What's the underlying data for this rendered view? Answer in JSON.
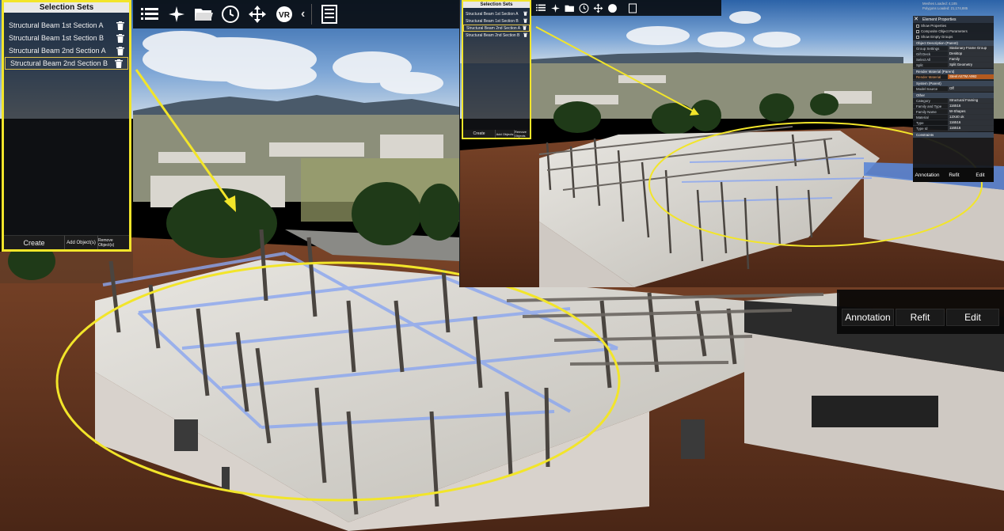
{
  "main_panel": {
    "title": "Selection Sets",
    "items": [
      {
        "label": "Structural Beam 1st Section A"
      },
      {
        "label": "Structural Beam 1st Section B"
      },
      {
        "label": "Structural Beam 2nd Section A"
      },
      {
        "label": "Structural Beam 2nd Section B"
      }
    ],
    "create_label": "Create",
    "add_label": "Add Object(s)",
    "remove_label": "Remove Object(s)"
  },
  "main_actions": {
    "annotation_label": "Annotation",
    "refit_label": "Refit",
    "edit_label": "Edit"
  },
  "inset": {
    "panel_title": "Selection Sets",
    "items": [
      {
        "label": "Structural Beam 1st Section A"
      },
      {
        "label": "Structural Beam 1st Section B"
      },
      {
        "label": "Structural Beam 2nd Section A"
      },
      {
        "label": "Structural Beam 2nd Section B"
      }
    ],
    "create_label": "Create",
    "add_label": "Add Objects",
    "remove_label": "Remove Objects",
    "stats": {
      "meshes": "Meshes Loaded: 4,185",
      "polygons": "Polygons Loaded: 21,174,885"
    },
    "properties": {
      "title": "Element Properties",
      "checks": [
        "Show Properties",
        "Composite Object Parameters",
        "Show Empty Groups"
      ],
      "sections": [
        {
          "name": "Object Description (Parent)",
          "rows": [
            {
              "k": "Group Settings",
              "v": "Stationary Frame Group"
            },
            {
              "k": "Gift Deck",
              "v": "Desktop"
            },
            {
              "k": "Select All",
              "v": "Family"
            },
            {
              "k": "Split",
              "v": "Split Geometry"
            }
          ]
        },
        {
          "name": "Render Material (Parent)",
          "rows": [
            {
              "k": "Render Material",
              "v": "Steel ASTM A992",
              "hl": true
            }
          ]
        },
        {
          "name": "System (Parent)",
          "rows": [
            {
              "k": "Model Source",
              "v": "Off"
            }
          ]
        },
        {
          "name": "Other",
          "rows": [
            {
              "k": "Category",
              "v": "Structural Framing"
            },
            {
              "k": "Family and Type",
              "v": "116516"
            },
            {
              "k": "Family Name",
              "v": "W-Shapes"
            },
            {
              "k": "Material",
              "v": "12X40 ok"
            },
            {
              "k": "Type",
              "v": "116516"
            },
            {
              "k": "Type Id",
              "v": "116516"
            }
          ]
        },
        {
          "name": "Constraints",
          "rows": []
        }
      ],
      "annotation_label": "Annotation",
      "refit_label": "Refit",
      "edit_label": "Edit"
    }
  },
  "colors": {
    "highlight": "#f2e52a",
    "beam_blue": "#8aa6f0",
    "sky": "#4f86c6",
    "dirt": "#6b3a22"
  },
  "icons": [
    "list-icon",
    "fly-icon",
    "folder-icon",
    "clock-icon",
    "move-icon",
    "vr-icon",
    "collapse-icon",
    "panel-icon",
    "trash-icon",
    "close-icon"
  ]
}
